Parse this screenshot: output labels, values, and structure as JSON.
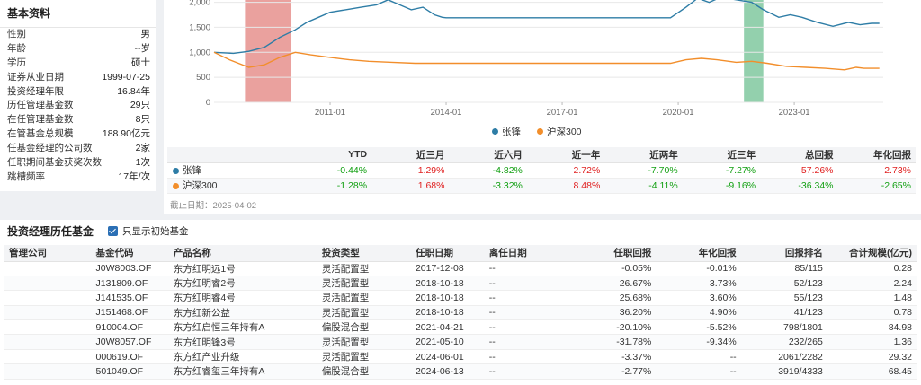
{
  "info": {
    "title": "基本资料",
    "rows": [
      {
        "label": "性别",
        "value": "男"
      },
      {
        "label": "年龄",
        "value": "--岁"
      },
      {
        "label": "学历",
        "value": "硕士"
      },
      {
        "label": "证券从业日期",
        "value": "1999-07-25"
      },
      {
        "label": "投资经理年限",
        "value": "16.84年"
      },
      {
        "label": "历任管理基金数",
        "value": "29只"
      },
      {
        "label": "在任管理基金数",
        "value": "8只"
      },
      {
        "label": "在管基金总规模",
        "value": "188.90亿元"
      },
      {
        "label": "任基金经理的公司数",
        "value": "2家"
      },
      {
        "label": "任职期间基金获奖次数",
        "value": "1次"
      },
      {
        "label": "跳槽频率",
        "value": "17年/次"
      }
    ]
  },
  "chart_data": {
    "type": "line",
    "y_ticks": [
      "2,000",
      "1,500",
      "1,000",
      "500",
      "0"
    ],
    "y_values": [
      2000,
      1500,
      1000,
      500,
      0
    ],
    "x_ticks": [
      "2011-01",
      "2014-01",
      "2017-01",
      "2020-01",
      "2023-01"
    ],
    "x_tick_years": [
      2011,
      2014,
      2017,
      2020,
      2023
    ],
    "x_range": [
      2008.0,
      2025.3
    ],
    "ylim": [
      0,
      2100
    ],
    "shaded_periods": [
      {
        "from": 2008.8,
        "to": 2010.0,
        "color": "#d9534f"
      },
      {
        "from": 2021.7,
        "to": 2022.2,
        "color": "#3aaa6a"
      }
    ],
    "series": [
      {
        "name": "张锋",
        "color": "#2e7da6",
        "points": [
          [
            2008.0,
            1000
          ],
          [
            2008.5,
            980
          ],
          [
            2008.9,
            1020
          ],
          [
            2009.3,
            1100
          ],
          [
            2009.7,
            1300
          ],
          [
            2010.1,
            1450
          ],
          [
            2010.4,
            1600
          ],
          [
            2010.7,
            1700
          ],
          [
            2011.0,
            1800
          ],
          [
            2011.4,
            1850
          ],
          [
            2011.8,
            1900
          ],
          [
            2012.2,
            1950
          ],
          [
            2012.5,
            2050
          ],
          [
            2012.8,
            1950
          ],
          [
            2013.1,
            1850
          ],
          [
            2013.4,
            1900
          ],
          [
            2013.7,
            1750
          ],
          [
            2013.9,
            1700
          ],
          [
            2014.0,
            1690
          ],
          [
            2019.8,
            1690
          ],
          [
            2020.2,
            1900
          ],
          [
            2020.5,
            2080
          ],
          [
            2020.8,
            2000
          ],
          [
            2021.1,
            2100
          ],
          [
            2021.5,
            2050
          ],
          [
            2021.9,
            2000
          ],
          [
            2022.2,
            1850
          ],
          [
            2022.6,
            1700
          ],
          [
            2022.9,
            1750
          ],
          [
            2023.2,
            1700
          ],
          [
            2023.6,
            1600
          ],
          [
            2024.0,
            1520
          ],
          [
            2024.4,
            1600
          ],
          [
            2024.7,
            1550
          ],
          [
            2025.0,
            1580
          ],
          [
            2025.2,
            1580
          ]
        ]
      },
      {
        "name": "沪深300",
        "color": "#f28e2b",
        "points": [
          [
            2008.0,
            1000
          ],
          [
            2008.4,
            850
          ],
          [
            2008.9,
            700
          ],
          [
            2009.3,
            750
          ],
          [
            2009.7,
            900
          ],
          [
            2010.1,
            1000
          ],
          [
            2010.5,
            950
          ],
          [
            2011.0,
            900
          ],
          [
            2011.5,
            850
          ],
          [
            2012.0,
            820
          ],
          [
            2012.6,
            800
          ],
          [
            2013.2,
            780
          ],
          [
            2013.7,
            780
          ],
          [
            2014.0,
            780
          ],
          [
            2019.8,
            780
          ],
          [
            2020.2,
            850
          ],
          [
            2020.6,
            880
          ],
          [
            2021.0,
            850
          ],
          [
            2021.5,
            800
          ],
          [
            2021.9,
            820
          ],
          [
            2022.3,
            780
          ],
          [
            2022.8,
            720
          ],
          [
            2023.3,
            700
          ],
          [
            2023.8,
            680
          ],
          [
            2024.3,
            650
          ],
          [
            2024.6,
            700
          ],
          [
            2024.8,
            680
          ],
          [
            2025.2,
            680
          ]
        ]
      }
    ]
  },
  "legend": [
    {
      "name": "张锋",
      "color": "#2e7da6"
    },
    {
      "name": "沪深300",
      "color": "#f28e2b"
    }
  ],
  "stats": {
    "headers": [
      "",
      "YTD",
      "近三月",
      "近六月",
      "近一年",
      "近两年",
      "近三年",
      "总回报",
      "年化回报"
    ],
    "rows": [
      {
        "name": "张锋",
        "color": "#2e7da6",
        "values": [
          "-0.44%",
          "1.29%",
          "-4.82%",
          "2.72%",
          "-7.70%",
          "-7.27%",
          "57.26%",
          "2.73%"
        ]
      },
      {
        "name": "沪深300",
        "color": "#f28e2b",
        "values": [
          "-1.28%",
          "1.68%",
          "-3.32%",
          "8.48%",
          "-4.11%",
          "-9.16%",
          "-36.34%",
          "-2.65%"
        ]
      }
    ],
    "cut_date": "截止日期：2025-04-02"
  },
  "history": {
    "title": "投资经理历任基金",
    "checkbox_label": "只显示初始基金",
    "headers": [
      "管理公司",
      "基金代码",
      "产品名称",
      "投资类型",
      "任职日期",
      "离任日期",
      "任职回报",
      "年化回报",
      "回报排名",
      "合计规模(亿元)"
    ],
    "rows": [
      [
        "",
        "J0W8003.OF",
        "东方红明远1号",
        "灵活配置型",
        "2017-12-08",
        "--",
        "-0.05%",
        "-0.01%",
        "85/115",
        "0.28"
      ],
      [
        "",
        "J131809.OF",
        "东方红明睿2号",
        "灵活配置型",
        "2018-10-18",
        "--",
        "26.67%",
        "3.73%",
        "52/123",
        "2.24"
      ],
      [
        "",
        "J141535.OF",
        "东方红明睿4号",
        "灵活配置型",
        "2018-10-18",
        "--",
        "25.68%",
        "3.60%",
        "55/123",
        "1.48"
      ],
      [
        "",
        "J151468.OF",
        "东方红新公益",
        "灵活配置型",
        "2018-10-18",
        "--",
        "36.20%",
        "4.90%",
        "41/123",
        "0.78"
      ],
      [
        "",
        "910004.OF",
        "东方红启恒三年持有A",
        "偏股混合型",
        "2021-04-21",
        "--",
        "-20.10%",
        "-5.52%",
        "798/1801",
        "84.98"
      ],
      [
        "",
        "J0W8057.OF",
        "东方红明锋3号",
        "灵活配置型",
        "2021-05-10",
        "--",
        "-31.78%",
        "-9.34%",
        "232/265",
        "1.36"
      ],
      [
        "",
        "000619.OF",
        "东方红产业升级",
        "灵活配置型",
        "2024-06-01",
        "--",
        "-3.37%",
        "--",
        "2061/2282",
        "29.32"
      ],
      [
        "",
        "501049.OF",
        "东方红睿玺三年持有A",
        "偏股混合型",
        "2024-06-13",
        "--",
        "-2.77%",
        "--",
        "3919/4333",
        "68.45"
      ]
    ]
  }
}
